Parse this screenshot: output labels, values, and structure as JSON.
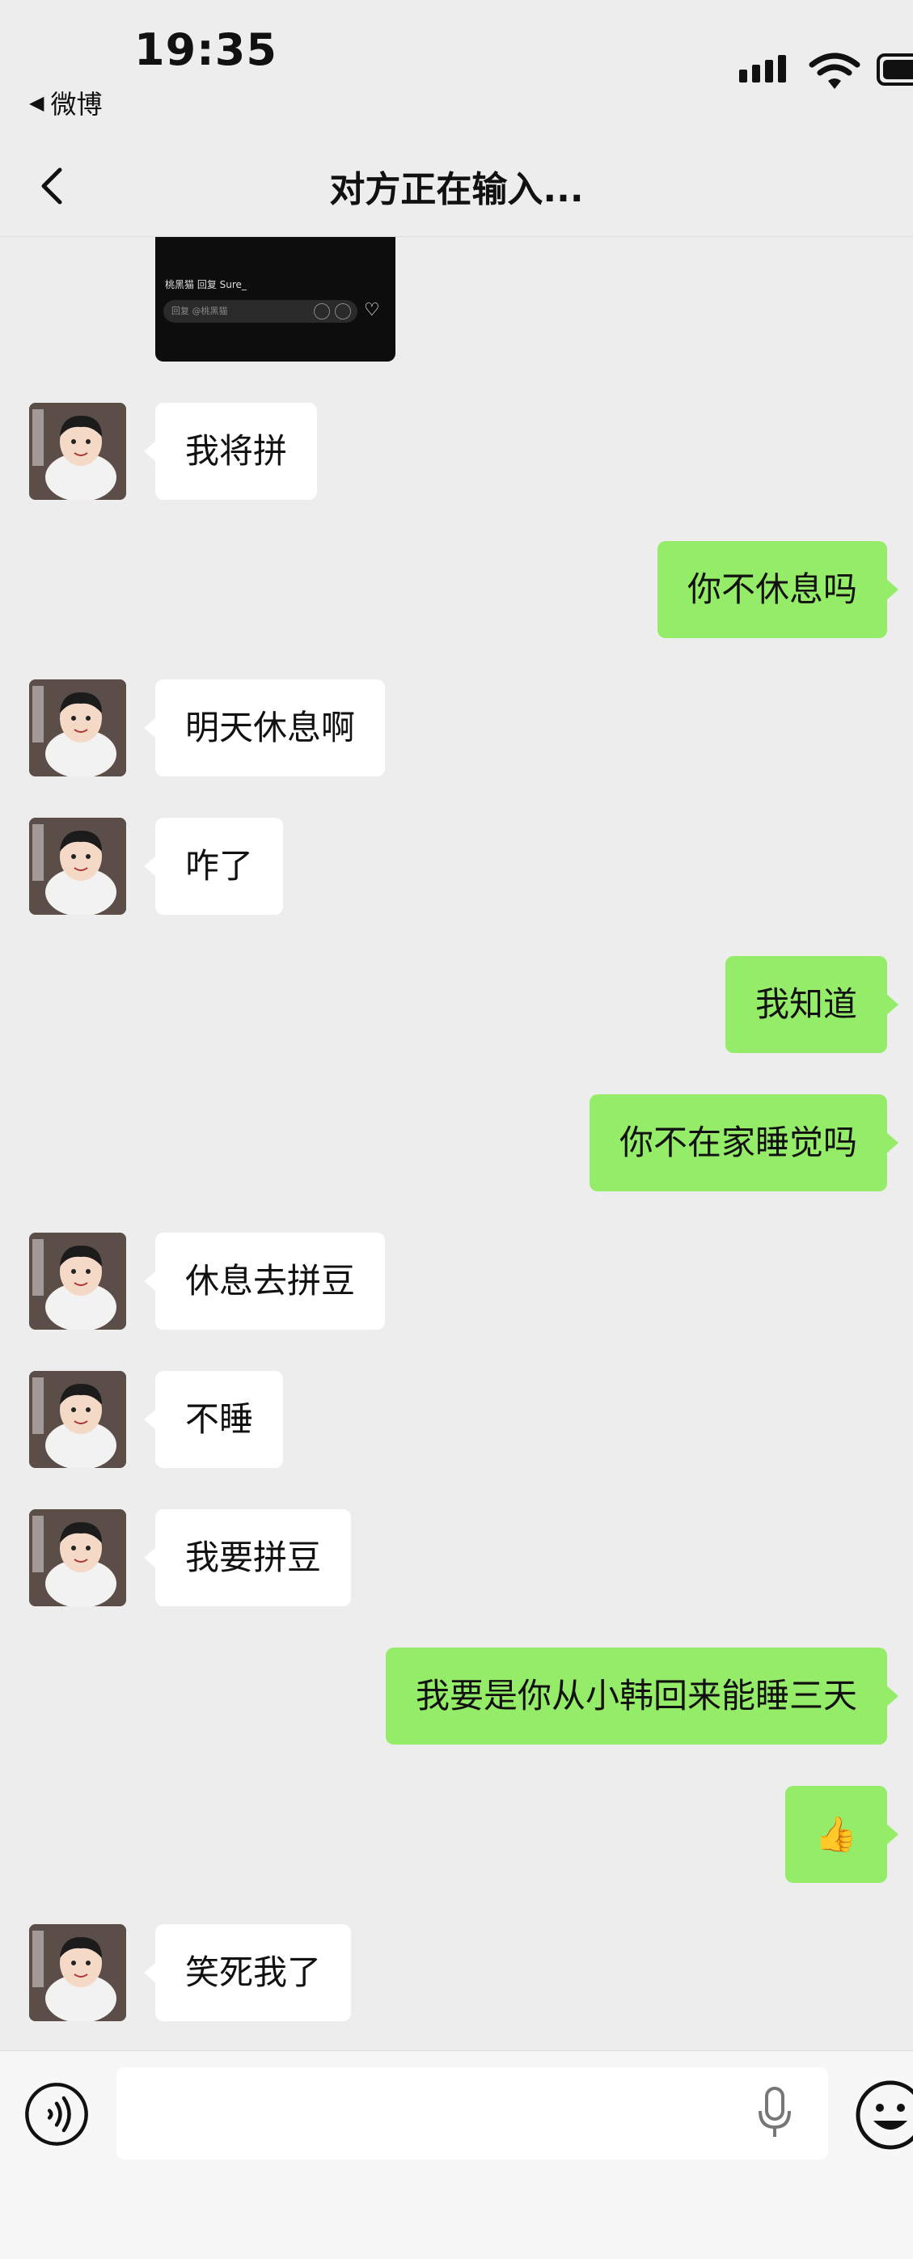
{
  "status_bar": {
    "time": "19:35",
    "back_app": "微博"
  },
  "nav": {
    "title": "对方正在输入..."
  },
  "video_thumb": {
    "caption": "桃黑猫 回复 Sure_",
    "reply": "回复 @桃黑猫"
  },
  "messages": [
    {
      "side": "left",
      "text": "我将拼"
    },
    {
      "side": "right",
      "text": "你不休息吗"
    },
    {
      "side": "left",
      "text": "明天休息啊"
    },
    {
      "side": "left",
      "text": "咋了"
    },
    {
      "side": "right",
      "text": "我知道"
    },
    {
      "side": "right",
      "text": "你不在家睡觉吗"
    },
    {
      "side": "left",
      "text": "休息去拼豆"
    },
    {
      "side": "left",
      "text": "不睡"
    },
    {
      "side": "left",
      "text": "我要拼豆"
    },
    {
      "side": "right",
      "text": "我要是你从小韩回来能睡三天"
    },
    {
      "side": "right",
      "text": "👍"
    },
    {
      "side": "left",
      "text": "笑死我了"
    }
  ],
  "input": {
    "value": "",
    "placeholder": ""
  },
  "icons": {
    "back": "chevron-left-icon",
    "voice": "voice-icon",
    "mic": "microphone-icon",
    "emoji": "emoji-icon"
  },
  "colors": {
    "background": "#ededed",
    "sent_bubble": "#95ec69",
    "received_bubble": "#ffffff"
  }
}
